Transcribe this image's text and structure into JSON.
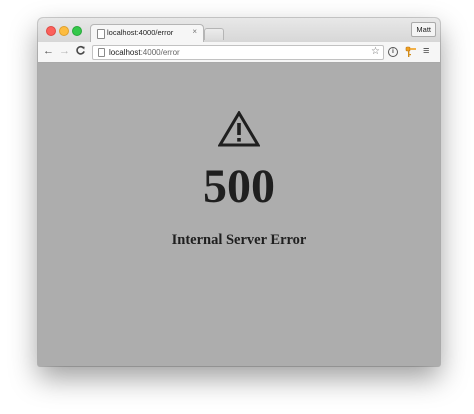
{
  "browser": {
    "tab": {
      "title": "localhost:4000/error",
      "close_glyph": "×",
      "favicon": "page-icon"
    },
    "profile_label": "Matt",
    "toolbar": {
      "back_glyph": "←",
      "forward_glyph": "→",
      "reload_glyph": "C",
      "address_host": "localhost",
      "address_path": ":4000/error",
      "star_glyph": "☆",
      "info_glyph": "i",
      "menu_glyph": "≡"
    }
  },
  "page": {
    "icon": "warning-icon",
    "status_code": "500",
    "status_message": "Internal Server Error",
    "background_color": "#adadad",
    "text_color": "#1f1f1f"
  }
}
